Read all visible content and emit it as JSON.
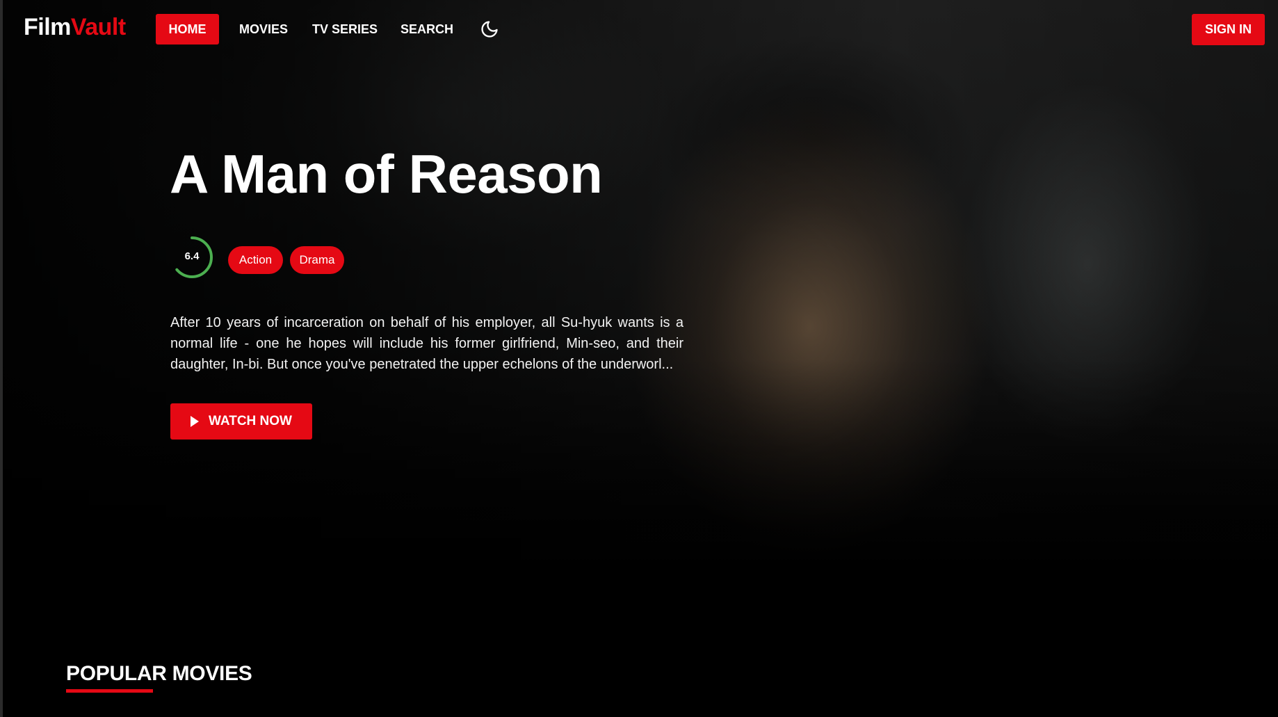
{
  "brand": {
    "name_part1": "Film",
    "name_part2": "Vault",
    "accent_color": "#e50914"
  },
  "nav": {
    "items": [
      {
        "label": "HOME",
        "active": true
      },
      {
        "label": "MOVIES",
        "active": false
      },
      {
        "label": "TV SERIES",
        "active": false
      },
      {
        "label": "SEARCH",
        "active": false
      }
    ],
    "theme_toggle_icon": "moon-icon",
    "sign_in_label": "SIGN IN"
  },
  "hero": {
    "title": "A Man of Reason",
    "rating": {
      "value": "6.4",
      "fraction": 0.64,
      "color": "#4caf50"
    },
    "genres": [
      "Action",
      "Drama"
    ],
    "overview": "After 10 years of incarceration on behalf of his employer, all Su-hyuk wants is a normal life - one he hopes will include his former girlfriend, Min-seo, and their daughter, In-bi. But once you've penetrated the upper echelons of the underworl...",
    "watch_label": "WATCH NOW",
    "watch_icon": "play-icon"
  },
  "sections": [
    {
      "title": "POPULAR MOVIES"
    }
  ]
}
